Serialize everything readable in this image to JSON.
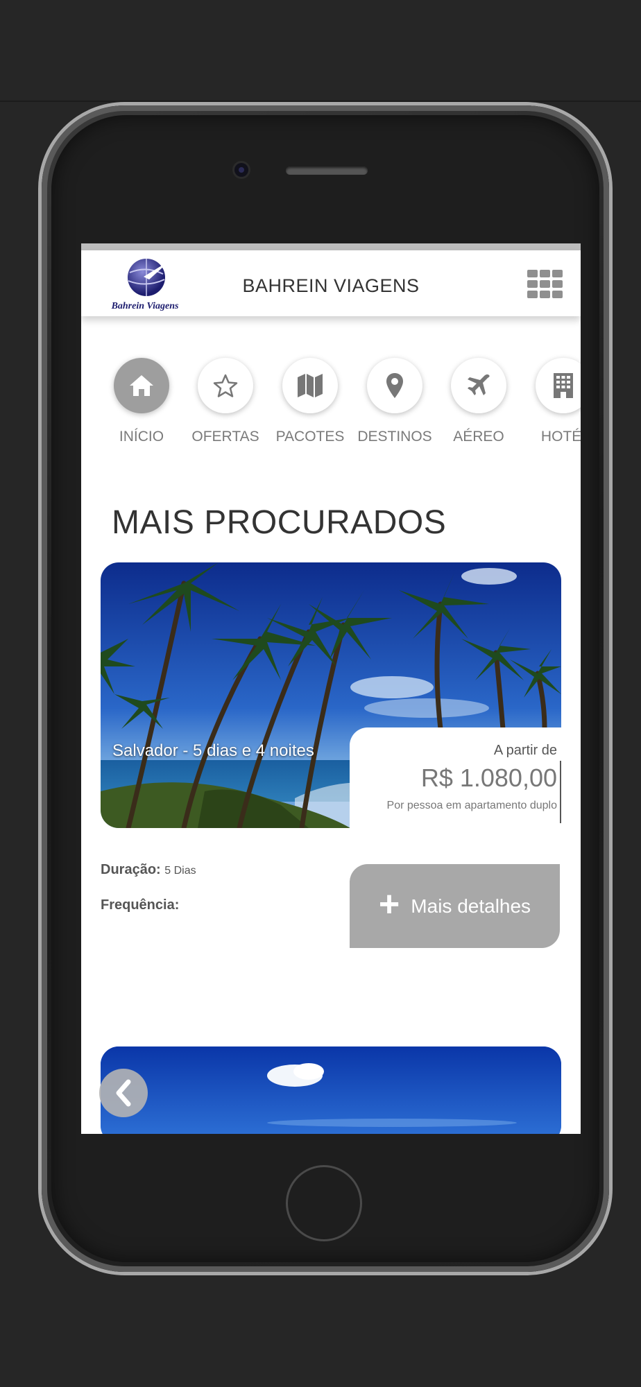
{
  "header": {
    "brand": "BAHREIN VIAGENS",
    "logo_text": "Bahrein Viagens",
    "menu_icon": "grid-menu-icon"
  },
  "categories": [
    {
      "label": "INÍCIO",
      "icon": "home-icon",
      "active": true
    },
    {
      "label": "OFERTAS",
      "icon": "star-icon",
      "active": false
    },
    {
      "label": "PACOTES",
      "icon": "map-icon",
      "active": false
    },
    {
      "label": "DESTINOS",
      "icon": "map-pin-icon",
      "active": false
    },
    {
      "label": "AÉREO",
      "icon": "airplane-icon",
      "active": false
    },
    {
      "label": "HOTÉI",
      "icon": "building-icon",
      "active": false
    }
  ],
  "section": {
    "title": "MAIS PROCURADOS"
  },
  "package": {
    "title": "Salvador - 5 dias e 4 noites",
    "price_from": "A partir de",
    "price": "R$ 1.080,00",
    "price_note": "Por pessoa em apartamento duplo",
    "duration_label": "Duração:",
    "duration_value": "5 Dias",
    "frequency_label": "Frequência:",
    "details_button": "Mais detalhes"
  },
  "colors": {
    "background": "#262626",
    "active_category": "#9e9e9e",
    "button_gray": "#a8a8a8"
  }
}
